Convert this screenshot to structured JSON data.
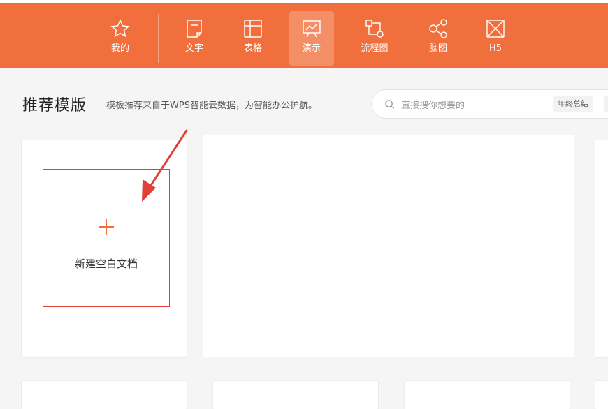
{
  "nav": {
    "items": [
      {
        "label": "我的",
        "icon": "star-icon"
      },
      {
        "label": "文字",
        "icon": "document-icon"
      },
      {
        "label": "表格",
        "icon": "table-icon"
      },
      {
        "label": "演示",
        "icon": "presentation-icon"
      },
      {
        "label": "流程图",
        "icon": "flowchart-icon"
      },
      {
        "label": "脑图",
        "icon": "mindmap-icon"
      },
      {
        "label": "H5",
        "icon": "h5-icon"
      }
    ],
    "active": "演示"
  },
  "header": {
    "title": "推荐模版",
    "description": "模板推荐来自于WPS智能云数据，为智能办公护航。"
  },
  "search": {
    "placeholder": "直接搜你想要的",
    "tags": [
      "年终总结",
      "简"
    ]
  },
  "blank_card": {
    "label": "新建空白文档"
  },
  "colors": {
    "brand": "#f06f3c",
    "highlight": "#e0403a"
  }
}
